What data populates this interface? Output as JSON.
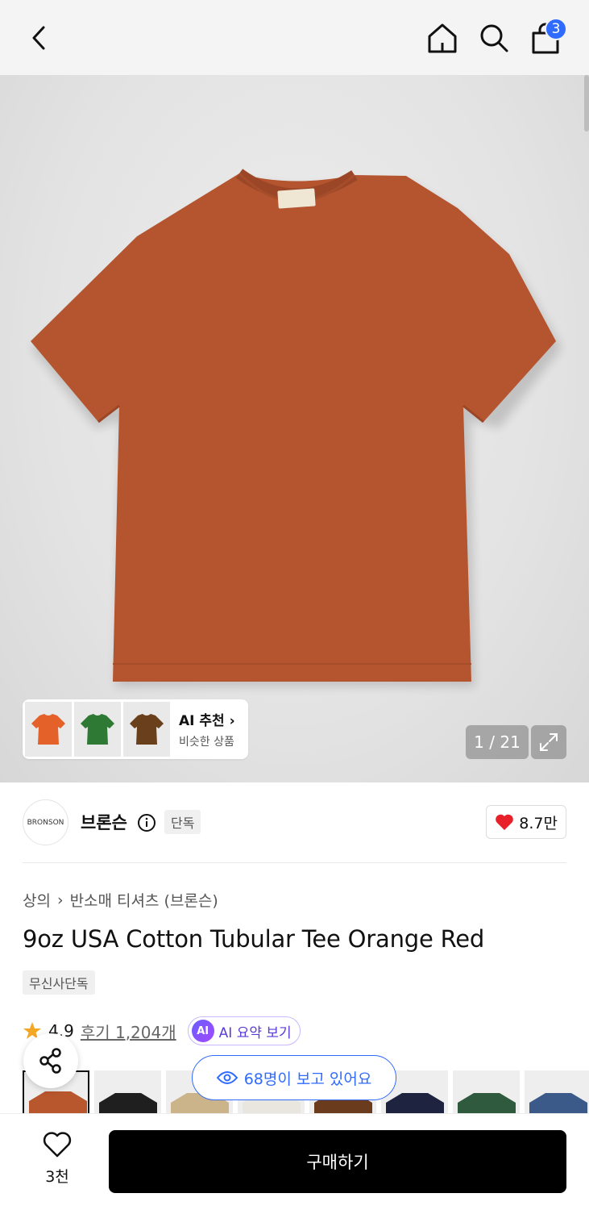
{
  "header": {
    "back_icon": "chevron-left-icon",
    "home_icon": "home-icon",
    "search_icon": "search-icon",
    "cart_icon": "shopping-bag-icon",
    "cart_count": "3"
  },
  "gallery": {
    "counter": "1 / 21",
    "expand_icon": "expand-icon",
    "ai_reco": {
      "title": "AI 추천",
      "subtitle": "비슷한 상품",
      "thumb_colors": [
        "#e4622a",
        "#2e7a35",
        "#6a3f1b"
      ]
    }
  },
  "brand": {
    "name": "브론슨",
    "logo_text": "BRONSON",
    "exclusive": "단독",
    "likes": "8.7만"
  },
  "product": {
    "breadcrumb_1": "상의",
    "breadcrumb_2": "반소매 티셔츠 (브론슨)",
    "title": "9oz USA Cotton Tubular Tee Orange Red",
    "tag": "무신사단독",
    "rating": "4.9",
    "reviews": "후기 1,204개",
    "ai_summary": "AI 요약 보기",
    "ai_badge": "AI"
  },
  "swatch_colors": [
    "#b8562e",
    "#1f1f1f",
    "#cbb38a",
    "#e9e6df",
    "#6b3b1e",
    "#1e2340",
    "#2f5a3e",
    "#3b5a8a"
  ],
  "viewers": "68명이 보고 있어요",
  "bottom": {
    "like_count": "3천",
    "buy_label": "구매하기"
  },
  "colors": {
    "accent_blue": "#2f6bff",
    "ai_purple": "#5a3bd8",
    "heart_red": "#e8202a",
    "tee": "#b4552f"
  }
}
